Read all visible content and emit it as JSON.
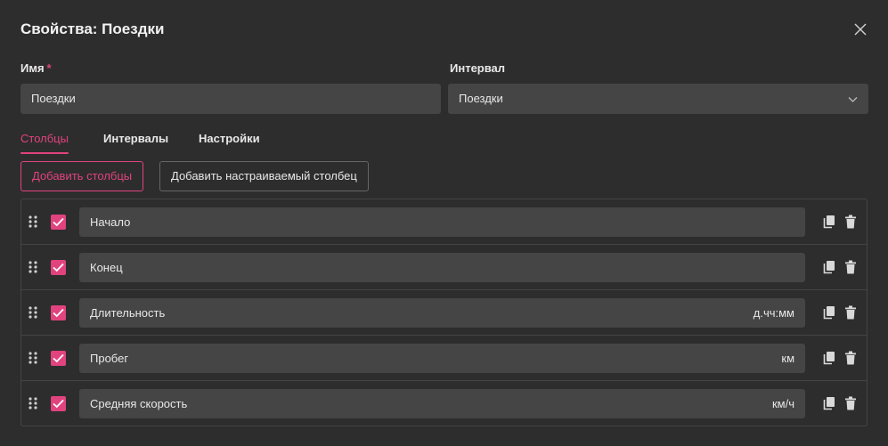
{
  "dialog": {
    "title": "Свойства: Поездки"
  },
  "form": {
    "name_label": "Имя",
    "name_required_mark": "*",
    "name_value": "Поездки",
    "interval_label": "Интервал",
    "interval_value": "Поездки"
  },
  "tabs": [
    {
      "label": "Столбцы",
      "active": true
    },
    {
      "label": "Интервалы",
      "active": false
    },
    {
      "label": "Настройки",
      "active": false
    }
  ],
  "buttons": {
    "add_columns": "Добавить столбцы",
    "add_custom_column": "Добавить настраиваемый столбец"
  },
  "columns": [
    {
      "name": "Начало",
      "unit": "",
      "checked": true
    },
    {
      "name": "Конец",
      "unit": "",
      "checked": true
    },
    {
      "name": "Длительность",
      "unit": "д.чч:мм",
      "checked": true
    },
    {
      "name": "Пробег",
      "unit": "км",
      "checked": true
    },
    {
      "name": "Средняя скорость",
      "unit": "км/ч",
      "checked": true
    }
  ],
  "icons": {
    "close": "close-icon",
    "dropdown": "chevron-down-icon",
    "drag": "drag-handle-icon",
    "checkbox": "checkmark-icon",
    "copy": "copy-icon",
    "delete": "trash-icon"
  },
  "colors": {
    "accent": "#e0437e",
    "background": "#2d2d2d",
    "field": "#454545"
  }
}
